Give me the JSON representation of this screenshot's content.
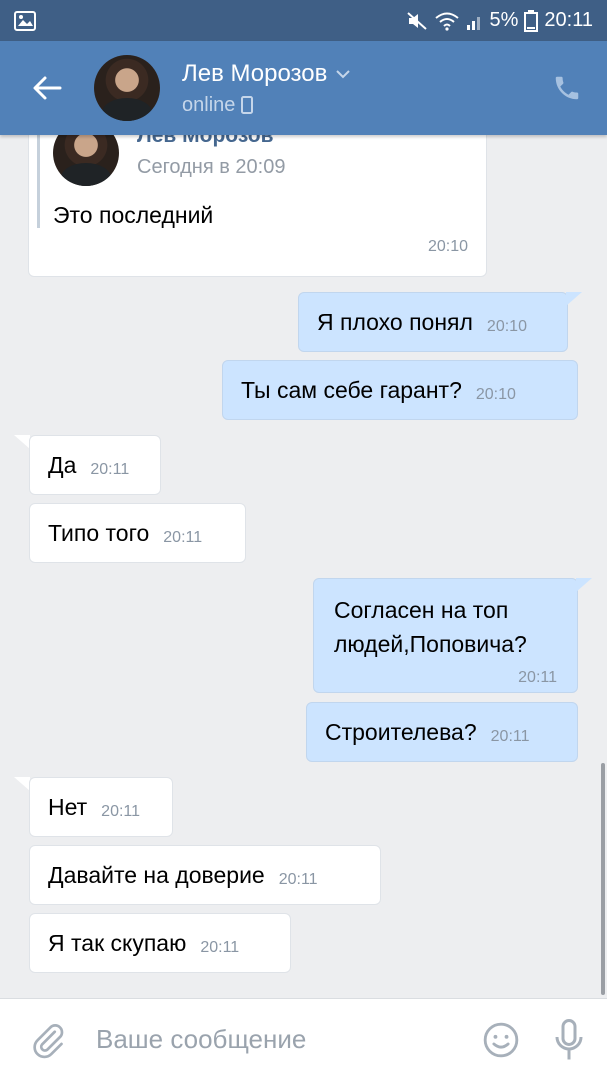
{
  "status_bar": {
    "battery": "5%",
    "time": "20:11"
  },
  "header": {
    "name": "Лев Морозов",
    "status": "online"
  },
  "forwarded": {
    "name": "Лев Морозов",
    "date": "Сегодня в 20:09",
    "text": "Это последний",
    "time": "20:10"
  },
  "messages": [
    {
      "text": "Я плохо понял",
      "time": "20:10"
    },
    {
      "text": "Ты сам себе гарант?",
      "time": "20:10"
    },
    {
      "text": "Да",
      "time": "20:11"
    },
    {
      "text": "Типо того",
      "time": "20:11"
    },
    {
      "line1": "Согласен на топ",
      "line2": "людей,Поповича?",
      "time": "20:11"
    },
    {
      "text": "Строителева?",
      "time": "20:11"
    },
    {
      "text": "Нет",
      "time": "20:11"
    },
    {
      "text": "Давайте на доверие",
      "time": "20:11"
    },
    {
      "text": "Я так скупаю",
      "time": "20:11"
    }
  ],
  "composer": {
    "placeholder": "Ваше сообщение"
  },
  "colors": {
    "header": "#5181b8",
    "status_bar": "#3f5f86",
    "incoming": "#ffffff",
    "outgoing": "#cce4ff",
    "background": "#edeef0"
  },
  "icons": [
    "gallery-icon",
    "mute-icon",
    "wifi-icon",
    "signal-icon",
    "battery-icon",
    "back-arrow-icon",
    "chevron-down-icon",
    "phone-device-icon",
    "call-icon",
    "paperclip-icon",
    "emoji-icon",
    "microphone-icon"
  ]
}
